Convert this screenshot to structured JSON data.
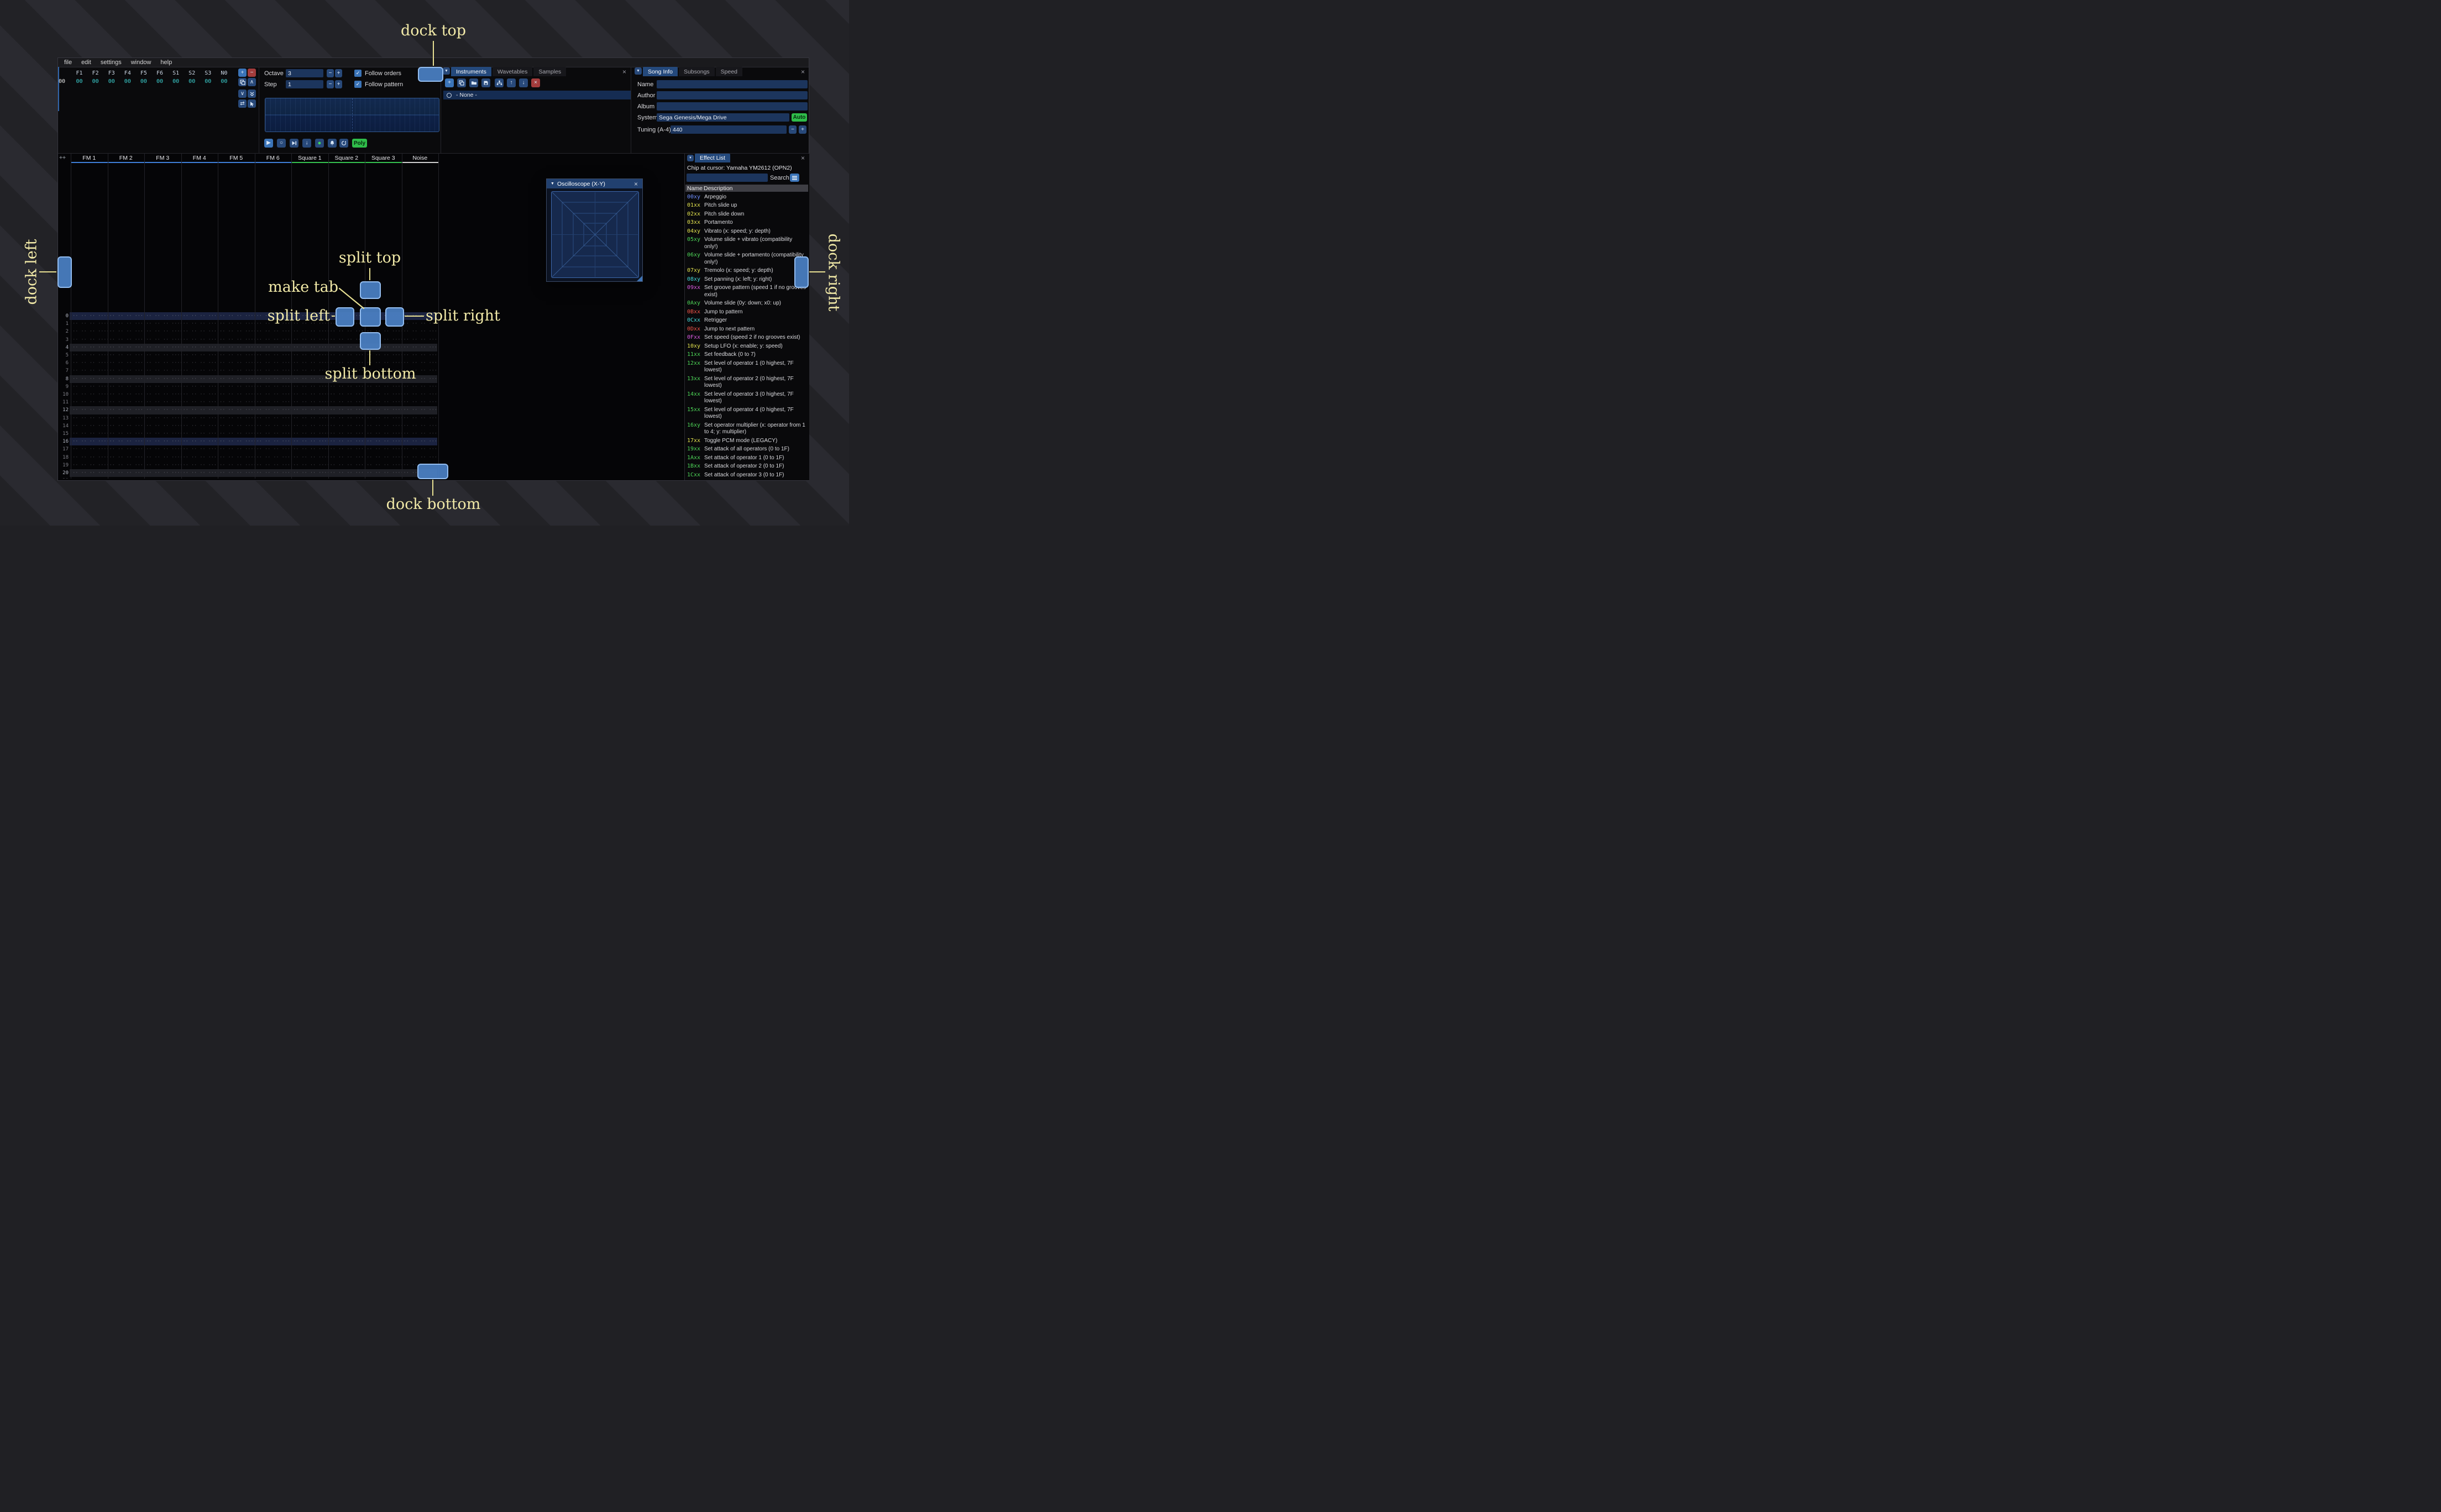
{
  "menu": {
    "items": [
      "file",
      "edit",
      "settings",
      "window",
      "help"
    ]
  },
  "glyphs": {
    "plus": "+",
    "minus": "−",
    "dropdown": "▼",
    "close": "×",
    "check": "✓",
    "chevron_up": "∧",
    "chevron_down": "∨",
    "swap": "⇄",
    "up_arrow": "↑",
    "down_arrow": "↓",
    "play": "▶",
    "circle": "○",
    "dot": "●"
  },
  "orders": {
    "row_label": "00",
    "channel_headers": [
      "F1",
      "F2",
      "F3",
      "F4",
      "F5",
      "F6",
      "S1",
      "S2",
      "S3",
      "N0"
    ],
    "row_values": [
      "00",
      "00",
      "00",
      "00",
      "00",
      "00",
      "00",
      "00",
      "00",
      "00"
    ]
  },
  "controls": {
    "octave_label": "Octave",
    "octave_value": "3",
    "step_label": "Step",
    "step_value": "1",
    "follow_orders": "Follow orders",
    "follow_pattern": "Follow pattern",
    "poly_label": "Poly"
  },
  "instruments": {
    "tabs": [
      "Instruments",
      "Wavetables",
      "Samples"
    ],
    "active_tab": 0,
    "selected_item": "- None -"
  },
  "song_info": {
    "tabs": [
      "Song Info",
      "Subsongs",
      "Speed"
    ],
    "active_tab": 0,
    "name_label": "Name",
    "name_value": "",
    "author_label": "Author",
    "author_value": "",
    "album_label": "Album",
    "album_value": "",
    "system_label": "System",
    "system_value": "Sega Genesis/Mega Drive",
    "auto_label": "Auto",
    "tuning_label": "Tuning (A-4)",
    "tuning_value": "440"
  },
  "pattern": {
    "add_button": "++",
    "row_count": 22,
    "empty_cell": "··· ·· ·· ···",
    "channels": [
      {
        "name": "FM 1",
        "type": "fm"
      },
      {
        "name": "FM 2",
        "type": "fm"
      },
      {
        "name": "FM 3",
        "type": "fm"
      },
      {
        "name": "FM 4",
        "type": "fm"
      },
      {
        "name": "FM 5",
        "type": "fm"
      },
      {
        "name": "FM 6",
        "type": "fm"
      },
      {
        "name": "Square 1",
        "type": "square"
      },
      {
        "name": "Square 2",
        "type": "square"
      },
      {
        "name": "Square 3",
        "type": "square"
      },
      {
        "name": "Noise",
        "type": "noise"
      }
    ],
    "channel_colors": {
      "fm": "#3f7fd9",
      "square": "#35c24f",
      "noise": "#d0d0d0"
    }
  },
  "oscilloscope": {
    "title": "Oscilloscope (X-Y)"
  },
  "effect_list": {
    "title": "Effect List",
    "chip_line": "Chip at cursor: Yamaha YM2612 (OPN2)",
    "search_label": "Search",
    "columns": {
      "name": "Name",
      "description": "Description"
    },
    "palette": {
      "blue": "#6f8fff",
      "yellow": "#e2e24e",
      "green": "#4ed658",
      "cyan": "#43d8d8",
      "magenta": "#d95ae0",
      "red": "#ef5348"
    },
    "effects": [
      {
        "code": "00xy",
        "c": "blue",
        "desc": "Arpeggio"
      },
      {
        "code": "01xx",
        "c": "yellow",
        "desc": "Pitch slide up"
      },
      {
        "code": "02xx",
        "c": "yellow",
        "desc": "Pitch slide down"
      },
      {
        "code": "03xx",
        "c": "yellow",
        "desc": "Portamento"
      },
      {
        "code": "04xy",
        "c": "yellow",
        "desc": "Vibrato (x: speed; y: depth)"
      },
      {
        "code": "05xy",
        "c": "green",
        "desc": "Volume slide + vibrato (compatibility only!)"
      },
      {
        "code": "06xy",
        "c": "green",
        "desc": "Volume slide + portamento (compatibility only!)"
      },
      {
        "code": "07xy",
        "c": "yellow",
        "desc": "Tremolo (x: speed; y: depth)"
      },
      {
        "code": "08xy",
        "c": "cyan",
        "desc": "Set panning (x: left; y: right)"
      },
      {
        "code": "09xx",
        "c": "magenta",
        "desc": "Set groove pattern (speed 1 if no grooves exist)"
      },
      {
        "code": "0Axy",
        "c": "green",
        "desc": "Volume slide (0y: down; x0: up)"
      },
      {
        "code": "0Bxx",
        "c": "red",
        "desc": "Jump to pattern"
      },
      {
        "code": "0Cxx",
        "c": "cyan",
        "desc": "Retrigger"
      },
      {
        "code": "0Dxx",
        "c": "red",
        "desc": "Jump to next pattern"
      },
      {
        "code": "0Fxx",
        "c": "magenta",
        "desc": "Set speed (speed 2 if no grooves exist)"
      },
      {
        "code": "10xy",
        "c": "yellow",
        "desc": "Setup LFO (x: enable; y: speed)"
      },
      {
        "code": "11xx",
        "c": "green",
        "desc": "Set feedback (0 to 7)"
      },
      {
        "code": "12xx",
        "c": "green",
        "desc": "Set level of operator 1 (0 highest, 7F lowest)"
      },
      {
        "code": "13xx",
        "c": "green",
        "desc": "Set level of operator 2 (0 highest, 7F lowest)"
      },
      {
        "code": "14xx",
        "c": "green",
        "desc": "Set level of operator 3 (0 highest, 7F lowest)"
      },
      {
        "code": "15xx",
        "c": "green",
        "desc": "Set level of operator 4 (0 highest, 7F lowest)"
      },
      {
        "code": "16xy",
        "c": "green",
        "desc": "Set operator multiplier (x: operator from 1 to 4; y: multiplier)"
      },
      {
        "code": "17xx",
        "c": "yellow",
        "desc": "Toggle PCM mode (LEGACY)"
      },
      {
        "code": "19xx",
        "c": "green",
        "desc": "Set attack of all operators (0 to 1F)"
      },
      {
        "code": "1Axx",
        "c": "green",
        "desc": "Set attack of operator 1 (0 to 1F)"
      },
      {
        "code": "1Bxx",
        "c": "green",
        "desc": "Set attack of operator 2 (0 to 1F)"
      },
      {
        "code": "1Cxx",
        "c": "green",
        "desc": "Set attack of operator 3 (0 to 1F)"
      }
    ]
  },
  "overlay": {
    "dock_top": "dock top",
    "dock_bottom": "dock bottom",
    "dock_left": "dock left",
    "dock_right": "dock right",
    "split_top": "split top",
    "split_bottom": "split bottom",
    "split_left": "split left",
    "split_right": "split right",
    "make_tab": "make tab"
  }
}
